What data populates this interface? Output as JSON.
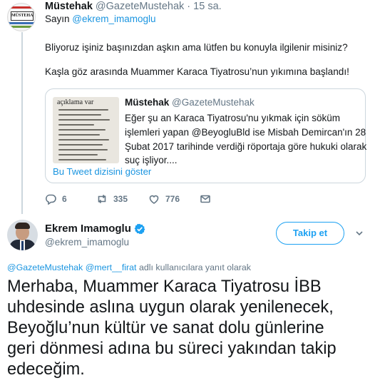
{
  "tweet1": {
    "display_name": "Müstehak",
    "handle": "@GazeteMustehak",
    "separator": "·",
    "time": "15 sa.",
    "reply_prefix": "Sayın",
    "reply_handle": "@ekrem_imamoglu",
    "text_line1": "Bliyoruz işiniz başınızdan aşkın ama lütfen bu konuyla ilgilenir misiniz?",
    "text_line2": "Kaşla göz arasında Muammer Karaca Tiyatrosu’nun yıkımına başlandı!",
    "avatar_text": "MÜSTEHAK",
    "quote": {
      "display_name": "Müstehak",
      "handle": "@GazeteMustehak",
      "thumb_caption": "açıklama var",
      "lines": [
        "Eğer şu an Karaca Tiyatrosu'nu yıkmak için söküm",
        "işlemleri yapan  @BeyogluBld ise Misbah Demircan'ın 28",
        "Şubat 2017 tarihinde verdiği röportaja göre hukuki olarak",
        "suç işliyor...."
      ],
      "show_thread": "Bu Tweet dizisini göster"
    },
    "actions": {
      "replies": "6",
      "retweets": "335",
      "likes": "776"
    }
  },
  "tweet2": {
    "display_name": "Ekrem Imamoglu",
    "handle": "@ekrem_imamoglu",
    "follow_label": "Takip et",
    "reply_context": {
      "handle1": "@GazeteMustehak",
      "handle2": "@mert__firat",
      "suffix": "adlı kullanıcılara yanıt olarak"
    },
    "text_lines": [
      "Merhaba, Muammer Karaca Tiyatrosu İBB",
      "uhdesinde aslına uygun olarak yenilenecek,",
      "Beyoğlu’nun kültür ve sanat dolu günlerine",
      "geri dönmesi adına bu süreci yakından takip",
      "edeceğim."
    ]
  },
  "colors": {
    "accent": "#1da1f2",
    "link": "#1b95e0",
    "muted": "#657786",
    "border": "#ccd6dd"
  },
  "icons": [
    "reply-icon",
    "retweet-icon",
    "like-icon",
    "dm-icon",
    "verified-icon",
    "caret-down-icon"
  ]
}
